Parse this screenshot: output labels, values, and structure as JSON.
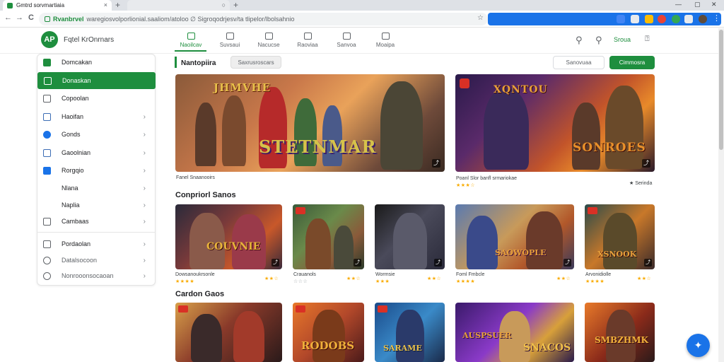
{
  "browser": {
    "tab_title": "Gmtrd sorvmartiaia",
    "site": "Rvanbrvel",
    "url_path": "waregiosvolporlionial.saaliom/atoloo  ∅  Sigroqodrjesv/ta tlipelor/lbolsahnio",
    "tab_close": "×",
    "new_tab": "+",
    "tab2_close": "○",
    "win_min": "—",
    "win_max": "▢",
    "win_close": "✕",
    "back": "←",
    "forward": "→",
    "reload": "C",
    "bookmark": "☆",
    "menu": "⋮"
  },
  "header": {
    "logo_text": "AP",
    "app_name": "Fqtel KrOnrnars",
    "tabs": [
      {
        "label": "Naoilcav"
      },
      {
        "label": "Suvsaui"
      },
      {
        "label": "Nacucse"
      },
      {
        "label": "Raoviaa"
      },
      {
        "label": "Sanvoa"
      },
      {
        "label": "Moaipa"
      }
    ],
    "search_icon": "⚲",
    "link": "Sroua",
    "help": "⍰"
  },
  "sidebar": {
    "items": [
      {
        "label": "Domcakan"
      },
      {
        "label": "Donaskan"
      },
      {
        "label": "Copoolan"
      },
      {
        "label": "Haoifan"
      },
      {
        "label": "Gonds"
      },
      {
        "label": "Gaoolnian"
      },
      {
        "label": "Rorgqio"
      },
      {
        "label": "Nlana"
      },
      {
        "label": "Naplia"
      },
      {
        "label": "Cambaas"
      },
      {
        "label": "Pordaolan"
      },
      {
        "label": "Datalsocoon"
      },
      {
        "label": "Nonrooonsocaoan"
      }
    ],
    "chevron": "›"
  },
  "main": {
    "breadcrumb_title": "Nantopiira",
    "breadcrumb_chip": "Saxrusroscars",
    "filter_label": "Sanovuaa",
    "action_label": "Cimmosra",
    "banner1": {
      "title": "STETNMAR",
      "title_top": "JHMVHE",
      "caption": "Fanel Snaanooirs",
      "share": "⤴"
    },
    "banner2": {
      "title": "SONROES",
      "title_top": "XQNTOU",
      "caption": "Poanl Slor banfl srmariokae",
      "rating": "★★★☆",
      "right_caption": "★ Serinda",
      "share": "⤴"
    },
    "section1": "Conpriorl Sanos",
    "section2": "Cardon Gaos",
    "row1": [
      {
        "title": "COUVNIE",
        "caption": "Dowsanoukrsonle",
        "rating": "★★★★",
        "right": "★★☆"
      },
      {
        "title": "",
        "caption": "Crauanols",
        "rating": "☆☆☆",
        "right": "★★☆"
      },
      {
        "title": "",
        "caption": "Wormsie",
        "rating": "★★★",
        "right": "★★☆"
      },
      {
        "title": "SAOWOPLE",
        "caption": "Foml Fmbcle",
        "rating": "★★★★",
        "right": "★★☆"
      },
      {
        "title": "XSNOOK",
        "caption": "Arvonidiolle",
        "rating": "★★★★",
        "right": "★★☆"
      }
    ],
    "row2": [
      {
        "title": ""
      },
      {
        "title": "RODOBS"
      },
      {
        "title": "SARAME"
      },
      {
        "title": "SNACOS",
        "title_top": "AUSPSUER"
      },
      {
        "title": "SMBZHMK"
      }
    ]
  },
  "fab_icon": "✦",
  "colors": {
    "accent": "#1e8e3e",
    "blue": "#1a73e8",
    "star": "#f9ab00"
  }
}
